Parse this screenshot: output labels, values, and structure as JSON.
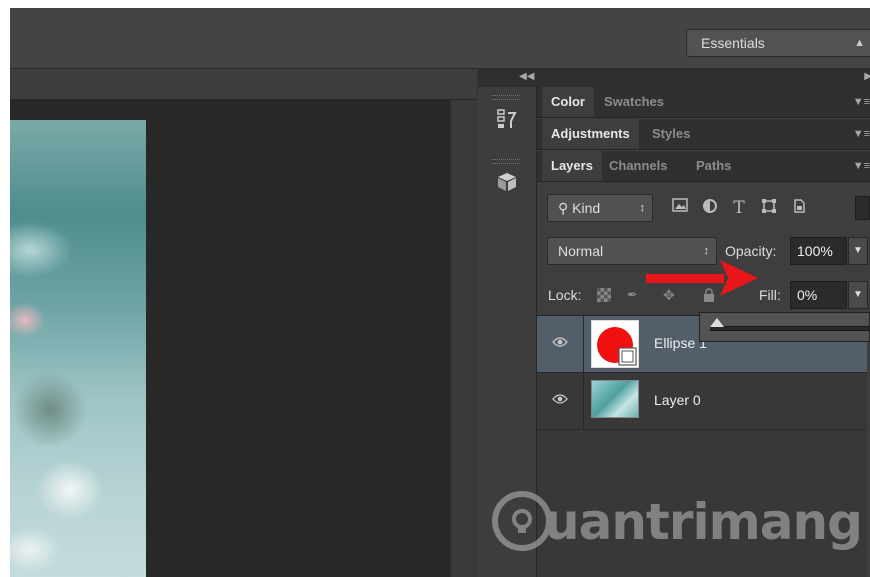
{
  "options_bar": {
    "workspace": {
      "label": "Essentials"
    }
  },
  "panels": {
    "color_group": {
      "tabs": [
        "Color",
        "Swatches"
      ]
    },
    "adjust_group": {
      "tabs": [
        "Adjustments",
        "Styles"
      ]
    },
    "layers_group": {
      "tabs": [
        "Layers",
        "Channels",
        "Paths"
      ]
    }
  },
  "layers_panel": {
    "filter_kind": "Kind",
    "filter_icons": [
      "image-filter-icon",
      "adjustment-filter-icon",
      "type-filter-icon",
      "shape-filter-icon",
      "smart-object-filter-icon"
    ],
    "blend_mode": "Normal",
    "opacity_label": "Opacity:",
    "opacity_value": "100%",
    "lock_label": "Lock:",
    "fill_label": "Fill:",
    "fill_value": "0%",
    "fill_slider_level": 0,
    "layers": [
      {
        "name": "Ellipse 1",
        "selected": true,
        "visible": true,
        "thumb": "red-ellipse-shape"
      },
      {
        "name": "Layer 0",
        "selected": false,
        "visible": true,
        "thumb": "teal-photo"
      }
    ]
  },
  "annotation": {
    "arrow_color": "#e8161b",
    "points_to": "Fill"
  },
  "watermark": {
    "text": "uantrimang"
  },
  "colors": {
    "panel_bg": "#3e3e3e",
    "selected_layer": "#535e6b",
    "ellipse_red": "#ff0000"
  }
}
